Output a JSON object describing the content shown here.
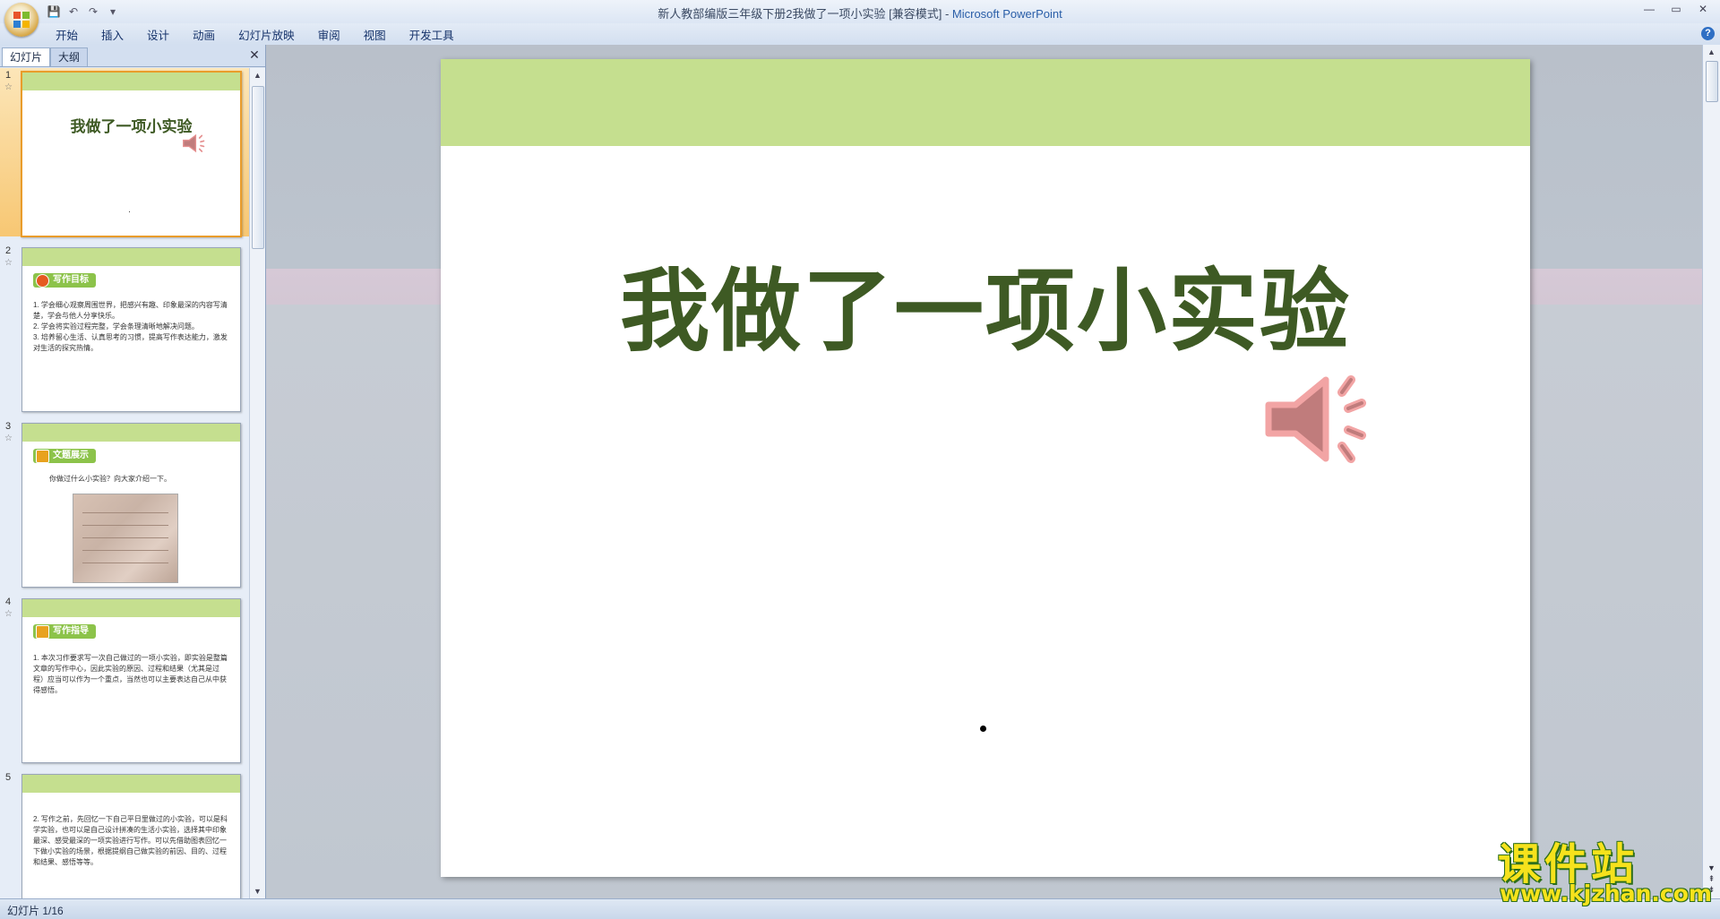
{
  "window": {
    "title_doc": "新人教部编版三年级下册2我做了一项小实验 [兼容模式]",
    "title_sep": " - ",
    "title_app": "Microsoft PowerPoint",
    "controls": [
      "—",
      "▭",
      "✕"
    ]
  },
  "qat": {
    "save": "💾",
    "undo": "↶",
    "redo": "↷",
    "customize": "▾"
  },
  "ribbon": {
    "tabs": [
      "开始",
      "插入",
      "设计",
      "动画",
      "幻灯片放映",
      "审阅",
      "视图",
      "开发工具"
    ],
    "help": "?"
  },
  "pane": {
    "tab_slides": "幻灯片",
    "tab_outline": "大纲",
    "close": "✕"
  },
  "thumbnails": [
    {
      "number": "1",
      "title": "我做了一项小实验",
      "dot": "·"
    },
    {
      "number": "2",
      "badge": "写作目标",
      "lines": [
        "1. 学会细心观察周围世界，把感兴有趣、印象最深的内容写清楚，学会与他人分享快乐。",
        "2. 学会将实验过程完整，学会条理清晰地解决问题。",
        "3. 培养留心生活、认真思考的习惯，提高写作表达能力，激发对生活的探究热情。"
      ]
    },
    {
      "number": "3",
      "badge": "文题展示",
      "text": "你做过什么小实验？向大家介绍一下。"
    },
    {
      "number": "4",
      "badge": "写作指导",
      "lines": [
        "1. 本次习作要求写一次自己做过的一项小实验，即实验是整篇文章的写作中心，因此实验的原因、过程和结果（尤其是过程）应当可以作为一个重点，当然也可以主要表达自己从中获得感悟。"
      ]
    },
    {
      "number": "5",
      "lines": [
        "2. 写作之前，先回忆一下自己平日里做过的小实验，可以是科学实验，也可以是自己设计拼凑的生活小实验，选择其中印象最深、感受最深的一项实验进行写作。可以先借助图表回忆一下做小实验的场景，根据提纲自己做实验的前因、目的、过程和结果、感悟等等。"
      ]
    }
  ],
  "slide": {
    "title": "我做了一项小实验"
  },
  "status": {
    "slide_info": "幻灯片 1/16"
  },
  "watermark": {
    "top": "课件站",
    "bottom": "www.kjzhan.com"
  },
  "colors": {
    "band": "#c5df8f",
    "title_text": "#3e5a24",
    "selection": "#f7c773"
  }
}
